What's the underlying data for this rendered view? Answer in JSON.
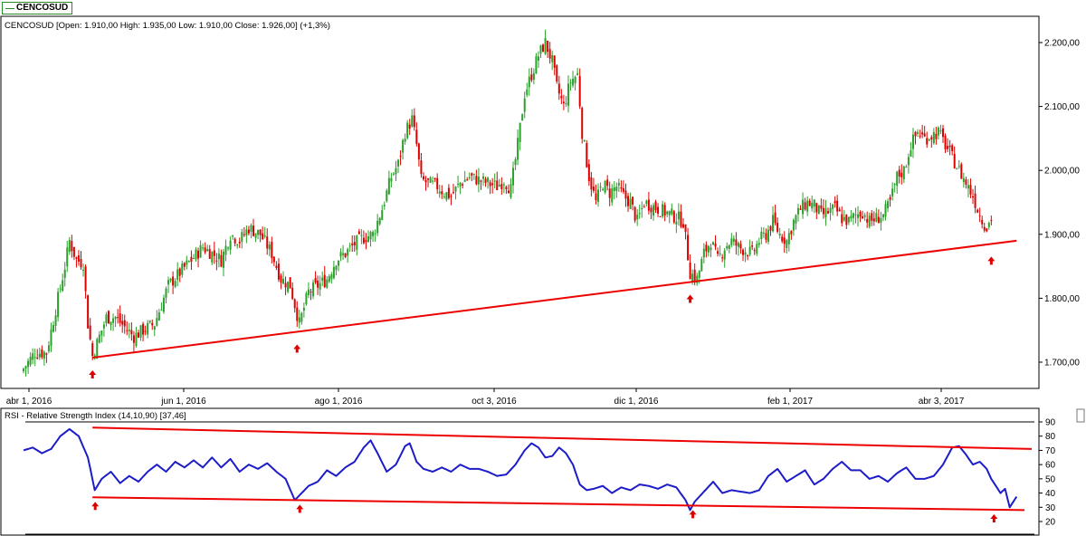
{
  "tab_label": "CENCOSUD",
  "colors": {
    "up_candle": "#2ca02c",
    "down_candle": "#dd0000",
    "trendline": "#ee0000",
    "rsi_line": "#1c1cc8",
    "markers": "#dd0000",
    "panel_border": "#000000",
    "background": "#ffffff"
  },
  "chart_data": [
    {
      "type": "candlestick",
      "title": "CENCOSUD [Open: 1.910,00  High: 1.935,00  Low: 1.910,00  Close: 1.926,00] (+1,3%)",
      "x_tick_labels": [
        "abr 1, 2016",
        "jun 1, 2016",
        "ago 1, 2016",
        "oct 3, 2016",
        "dic 1, 2016",
        "feb 1, 2017",
        "abr 3, 2017"
      ],
      "y_tick_labels": [
        "2.200,00",
        "2.100,00",
        "2.000,00",
        "1.900,00",
        "1.800,00",
        "1.700,00"
      ],
      "y_ticks": [
        2200,
        2100,
        2000,
        1900,
        1800,
        1700
      ],
      "ylim": [
        1650,
        2225
      ],
      "close_path": [
        [
          0,
          1690
        ],
        [
          5,
          1715
        ],
        [
          10,
          1715
        ],
        [
          15,
          1800
        ],
        [
          18,
          1850
        ],
        [
          20,
          1890
        ],
        [
          23,
          1860
        ],
        [
          26,
          1855
        ],
        [
          28,
          1760
        ],
        [
          30,
          1710
        ],
        [
          33,
          1740
        ],
        [
          36,
          1770
        ],
        [
          40,
          1770
        ],
        [
          44,
          1755
        ],
        [
          48,
          1740
        ],
        [
          52,
          1750
        ],
        [
          57,
          1760
        ],
        [
          63,
          1820
        ],
        [
          68,
          1840
        ],
        [
          73,
          1860
        ],
        [
          78,
          1880
        ],
        [
          82,
          1870
        ],
        [
          86,
          1860
        ],
        [
          90,
          1900
        ],
        [
          94,
          1890
        ],
        [
          98,
          1910
        ],
        [
          103,
          1900
        ],
        [
          108,
          1870
        ],
        [
          112,
          1830
        ],
        [
          116,
          1820
        ],
        [
          120,
          1760
        ],
        [
          124,
          1810
        ],
        [
          128,
          1820
        ],
        [
          132,
          1830
        ],
        [
          136,
          1860
        ],
        [
          140,
          1870
        ],
        [
          144,
          1885
        ],
        [
          148,
          1895
        ],
        [
          152,
          1900
        ],
        [
          156,
          1940
        ],
        [
          160,
          1990
        ],
        [
          163,
          2010
        ],
        [
          166,
          2060
        ],
        [
          169,
          2080
        ],
        [
          171,
          2040
        ],
        [
          173,
          1985
        ],
        [
          176,
          1980
        ],
        [
          180,
          1975
        ],
        [
          183,
          1965
        ],
        [
          186,
          1960
        ],
        [
          190,
          1980
        ],
        [
          194,
          1990
        ],
        [
          198,
          1985
        ],
        [
          202,
          1980
        ],
        [
          206,
          1975
        ],
        [
          209,
          1985
        ],
        [
          212,
          1970
        ],
        [
          215,
          2040
        ],
        [
          218,
          2120
        ],
        [
          221,
          2150
        ],
        [
          224,
          2180
        ],
        [
          227,
          2200
        ],
        [
          230,
          2170
        ],
        [
          232,
          2130
        ],
        [
          235,
          2100
        ],
        [
          238,
          2140
        ],
        [
          241,
          2150
        ],
        [
          243,
          2060
        ],
        [
          246,
          1990
        ],
        [
          249,
          1950
        ],
        [
          252,
          1980
        ],
        [
          255,
          1965
        ],
        [
          258,
          1975
        ],
        [
          261,
          1960
        ],
        [
          264,
          1950
        ],
        [
          267,
          1920
        ],
        [
          270,
          1950
        ],
        [
          273,
          1945
        ],
        [
          276,
          1940
        ],
        [
          279,
          1935
        ],
        [
          282,
          1930
        ],
        [
          285,
          1925
        ],
        [
          287,
          1920
        ],
        [
          290,
          1840
        ],
        [
          293,
          1830
        ],
        [
          296,
          1870
        ],
        [
          299,
          1890
        ],
        [
          302,
          1860
        ],
        [
          305,
          1880
        ],
        [
          308,
          1890
        ],
        [
          311,
          1880
        ],
        [
          314,
          1875
        ],
        [
          317,
          1870
        ],
        [
          320,
          1890
        ],
        [
          323,
          1900
        ],
        [
          326,
          1920
        ],
        [
          329,
          1900
        ],
        [
          332,
          1890
        ],
        [
          335,
          1920
        ],
        [
          338,
          1940
        ],
        [
          341,
          1950
        ],
        [
          344,
          1945
        ],
        [
          347,
          1930
        ],
        [
          350,
          1935
        ],
        [
          353,
          1940
        ],
        [
          356,
          1925
        ],
        [
          359,
          1920
        ],
        [
          362,
          1930
        ],
        [
          365,
          1935
        ],
        [
          368,
          1920
        ],
        [
          371,
          1925
        ],
        [
          374,
          1930
        ],
        [
          377,
          1950
        ],
        [
          380,
          1990
        ],
        [
          383,
          2000
        ],
        [
          386,
          2040
        ],
        [
          389,
          2060
        ],
        [
          392,
          2050
        ],
        [
          395,
          2055
        ],
        [
          398,
          2060
        ],
        [
          401,
          2040
        ],
        [
          404,
          2020
        ],
        [
          407,
          2000
        ],
        [
          410,
          1980
        ],
        [
          413,
          1960
        ],
        [
          416,
          1930
        ],
        [
          419,
          1910
        ],
        [
          421,
          1926
        ]
      ],
      "trendline": {
        "start": [
          30,
          1707
        ],
        "end": [
          432,
          1890
        ]
      },
      "markers_at_index": [
        30,
        119,
        290,
        421
      ]
    },
    {
      "type": "line",
      "title": "RSI - Relative Strength Index (14,10,90) [37,46]",
      "y_tick_labels": [
        "90",
        "80",
        "70",
        "60",
        "50",
        "40",
        "30",
        "20"
      ],
      "y_ticks": [
        90,
        80,
        70,
        60,
        50,
        40,
        30,
        20
      ],
      "ylim": [
        20,
        90
      ],
      "reference_lines": [
        90
      ],
      "series_path": [
        [
          0,
          70
        ],
        [
          4,
          72
        ],
        [
          8,
          68
        ],
        [
          12,
          71
        ],
        [
          16,
          80
        ],
        [
          20,
          85
        ],
        [
          24,
          80
        ],
        [
          28,
          65
        ],
        [
          31,
          42
        ],
        [
          34,
          50
        ],
        [
          38,
          55
        ],
        [
          42,
          47
        ],
        [
          46,
          52
        ],
        [
          50,
          48
        ],
        [
          54,
          55
        ],
        [
          58,
          60
        ],
        [
          62,
          55
        ],
        [
          66,
          62
        ],
        [
          70,
          58
        ],
        [
          74,
          63
        ],
        [
          78,
          58
        ],
        [
          82,
          65
        ],
        [
          86,
          58
        ],
        [
          90,
          64
        ],
        [
          94,
          55
        ],
        [
          98,
          60
        ],
        [
          102,
          57
        ],
        [
          106,
          61
        ],
        [
          110,
          55
        ],
        [
          114,
          50
        ],
        [
          118,
          35
        ],
        [
          121,
          40
        ],
        [
          124,
          45
        ],
        [
          128,
          48
        ],
        [
          132,
          56
        ],
        [
          136,
          52
        ],
        [
          140,
          58
        ],
        [
          144,
          62
        ],
        [
          148,
          72
        ],
        [
          151,
          77
        ],
        [
          154,
          68
        ],
        [
          158,
          55
        ],
        [
          162,
          60
        ],
        [
          166,
          73
        ],
        [
          168,
          75
        ],
        [
          171,
          62
        ],
        [
          174,
          57
        ],
        [
          178,
          55
        ],
        [
          182,
          58
        ],
        [
          186,
          55
        ],
        [
          190,
          60
        ],
        [
          194,
          57
        ],
        [
          198,
          57
        ],
        [
          202,
          55
        ],
        [
          206,
          52
        ],
        [
          210,
          53
        ],
        [
          214,
          60
        ],
        [
          218,
          70
        ],
        [
          221,
          75
        ],
        [
          224,
          72
        ],
        [
          227,
          65
        ],
        [
          230,
          66
        ],
        [
          233,
          72
        ],
        [
          236,
          68
        ],
        [
          239,
          60
        ],
        [
          242,
          46
        ],
        [
          245,
          42
        ],
        [
          248,
          43
        ],
        [
          252,
          45
        ],
        [
          256,
          40
        ],
        [
          260,
          44
        ],
        [
          264,
          42
        ],
        [
          268,
          46
        ],
        [
          272,
          45
        ],
        [
          276,
          43
        ],
        [
          280,
          46
        ],
        [
          284,
          44
        ],
        [
          288,
          35
        ],
        [
          290,
          28
        ],
        [
          292,
          34
        ],
        [
          296,
          41
        ],
        [
          300,
          48
        ],
        [
          304,
          40
        ],
        [
          308,
          42
        ],
        [
          312,
          41
        ],
        [
          316,
          40
        ],
        [
          320,
          42
        ],
        [
          324,
          52
        ],
        [
          328,
          57
        ],
        [
          332,
          48
        ],
        [
          336,
          52
        ],
        [
          340,
          56
        ],
        [
          344,
          46
        ],
        [
          348,
          50
        ],
        [
          352,
          57
        ],
        [
          356,
          62
        ],
        [
          360,
          56
        ],
        [
          364,
          56
        ],
        [
          368,
          50
        ],
        [
          372,
          52
        ],
        [
          376,
          48
        ],
        [
          380,
          54
        ],
        [
          384,
          58
        ],
        [
          388,
          50
        ],
        [
          392,
          50
        ],
        [
          396,
          52
        ],
        [
          400,
          60
        ],
        [
          404,
          72
        ],
        [
          407,
          73
        ],
        [
          410,
          67
        ],
        [
          413,
          60
        ],
        [
          416,
          62
        ],
        [
          419,
          57
        ],
        [
          421,
          50
        ],
        [
          423,
          45
        ],
        [
          425,
          40
        ],
        [
          427,
          43
        ],
        [
          429,
          30
        ],
        [
          432,
          37.46
        ]
      ],
      "upper_trendline": {
        "start": [
          30,
          86
        ],
        "end": [
          432,
          71
        ]
      },
      "lower_trendline": {
        "start": [
          30,
          37
        ],
        "end": [
          432,
          28
        ]
      },
      "markers_at_index": [
        30,
        119,
        290,
        421
      ]
    }
  ]
}
